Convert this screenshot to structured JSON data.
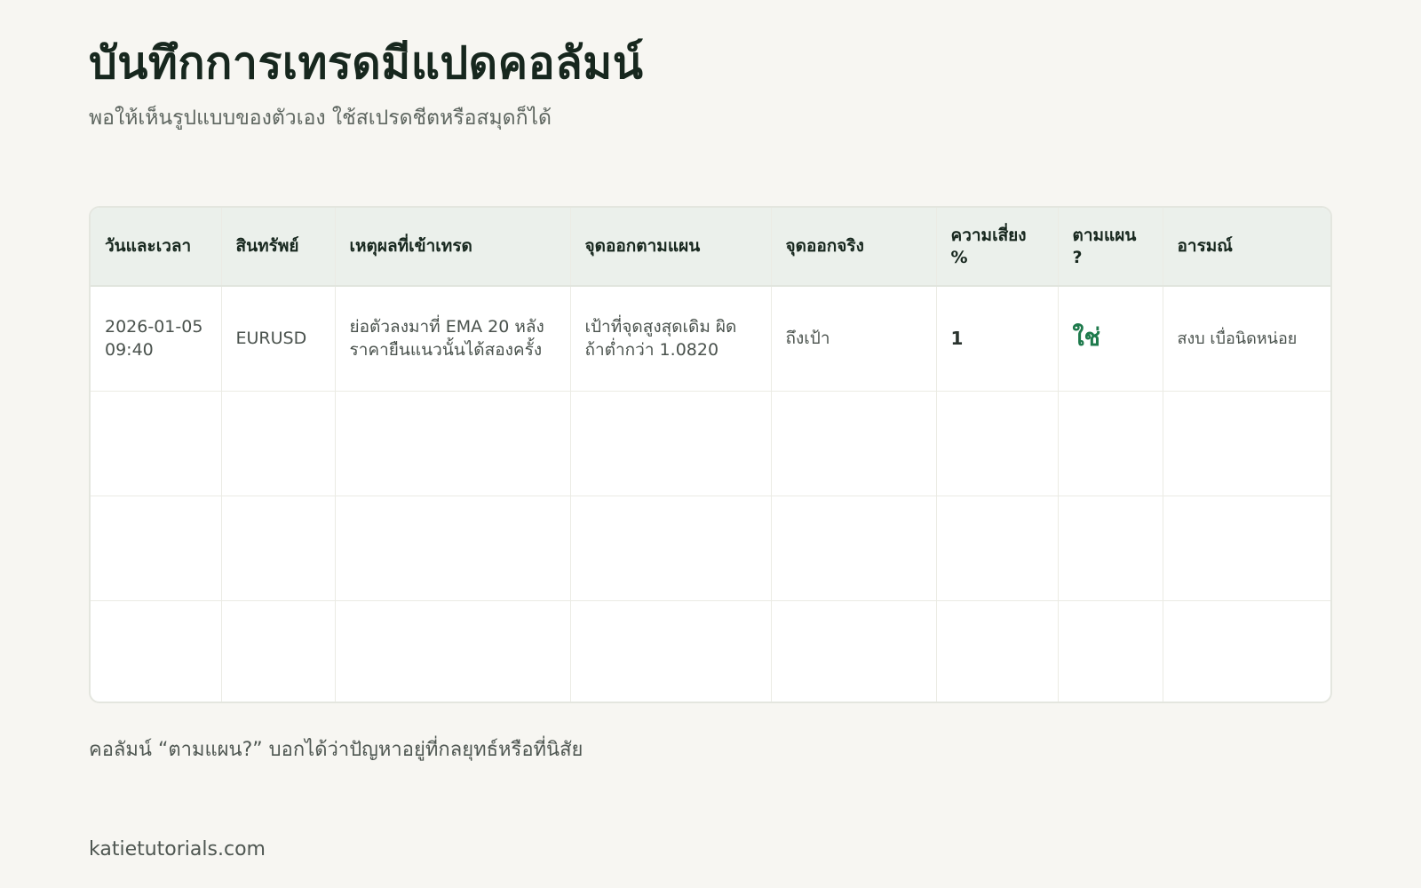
{
  "header": {
    "title": "บันทึกการเทรดมีแปดคอลัมน์",
    "subtitle": "พอให้เห็นรูปแบบของตัวเอง ใช้สเปรดชีตหรือสมุดก็ได้"
  },
  "table": {
    "columns": [
      "วันและเวลา",
      "สินทรัพย์",
      "เหตุผลที่เข้าเทรด",
      "จุดออกตามแผน",
      "จุดออกจริง",
      "ความเสี่ยง %",
      "ตามแผน ?",
      "อารมณ์"
    ],
    "rows": [
      {
        "datetime": "2026-01-05 09:40",
        "asset": "EURUSD",
        "reason": "ย่อตัวลงมาที่ EMA 20 หลังราคายืนแนวนั้นได้สองครั้ง",
        "planned_exit": "เป้าที่จุดสูงสุดเดิม ผิดถ้าต่ำกว่า 1.0820",
        "actual_exit": "ถึงเป้า",
        "risk_pct": "1",
        "followed_plan": "ใช่",
        "emotion": "สงบ เบื่อนิดหน่อย"
      },
      {
        "datetime": "",
        "asset": "",
        "reason": "",
        "planned_exit": "",
        "actual_exit": "",
        "risk_pct": "",
        "followed_plan": "",
        "emotion": ""
      },
      {
        "datetime": "",
        "asset": "",
        "reason": "",
        "planned_exit": "",
        "actual_exit": "",
        "risk_pct": "",
        "followed_plan": "",
        "emotion": ""
      },
      {
        "datetime": "",
        "asset": "",
        "reason": "",
        "planned_exit": "",
        "actual_exit": "",
        "risk_pct": "",
        "followed_plan": "",
        "emotion": ""
      }
    ]
  },
  "footnote": "คอลัมน์ “ตามแผน?” บอกได้ว่าปัญหาอยู่ที่กลยุทธ์หรือที่นิสัย",
  "site": "katietutorials.com",
  "colors": {
    "background": "#f7f6f2",
    "header_row": "#ebf0eb",
    "title": "#17271e",
    "plan_yes": "#1e7a4c"
  }
}
